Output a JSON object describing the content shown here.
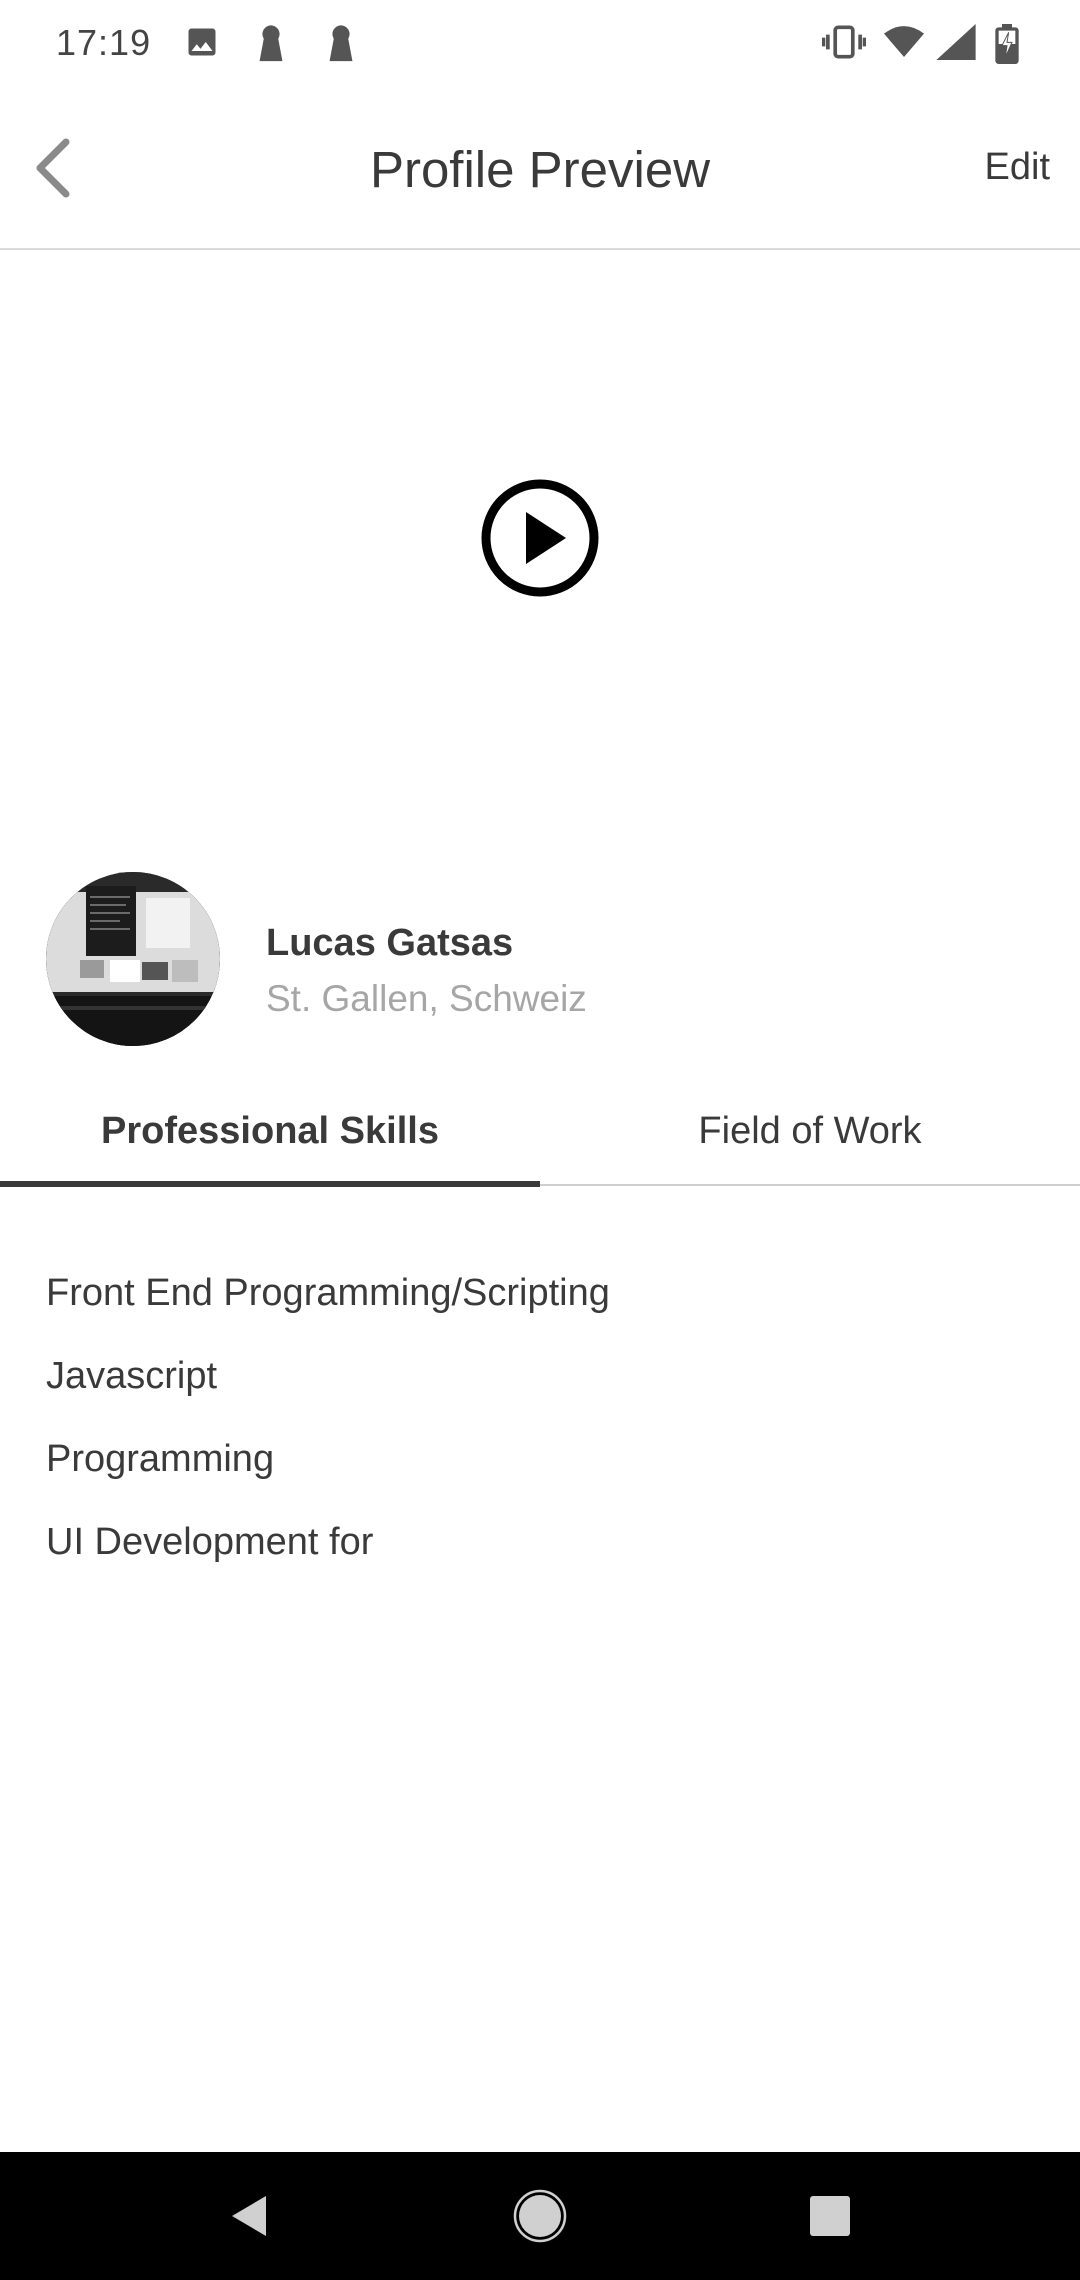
{
  "status_bar": {
    "time": "17:19",
    "left_icons": [
      "image-icon",
      "keyhole-icon",
      "keyhole-icon"
    ],
    "right_icons": [
      "vibrate-icon",
      "wifi-icon",
      "signal-icon",
      "battery-charging-icon"
    ]
  },
  "header": {
    "title": "Profile Preview",
    "edit_label": "Edit",
    "back_icon": "chevron-left-icon"
  },
  "video": {
    "play_icon": "play-circle-icon"
  },
  "profile": {
    "name": "Lucas Gatsas",
    "location": "St. Gallen, Schweiz"
  },
  "tabs": [
    {
      "label": "Professional Skills",
      "active": true
    },
    {
      "label": "Field of Work",
      "active": false
    }
  ],
  "skills": [
    "Front End Programming/Scripting",
    "Javascript",
    "Programming",
    "UI Development for"
  ],
  "nav_bar": {
    "buttons": [
      "back-triangle-icon",
      "home-circle-icon",
      "recents-square-icon"
    ]
  },
  "colors": {
    "text_primary": "#3a3a3a",
    "text_secondary": "#a6a6a6",
    "divider": "#d9d9d9",
    "nav_bar_bg": "#000000"
  }
}
